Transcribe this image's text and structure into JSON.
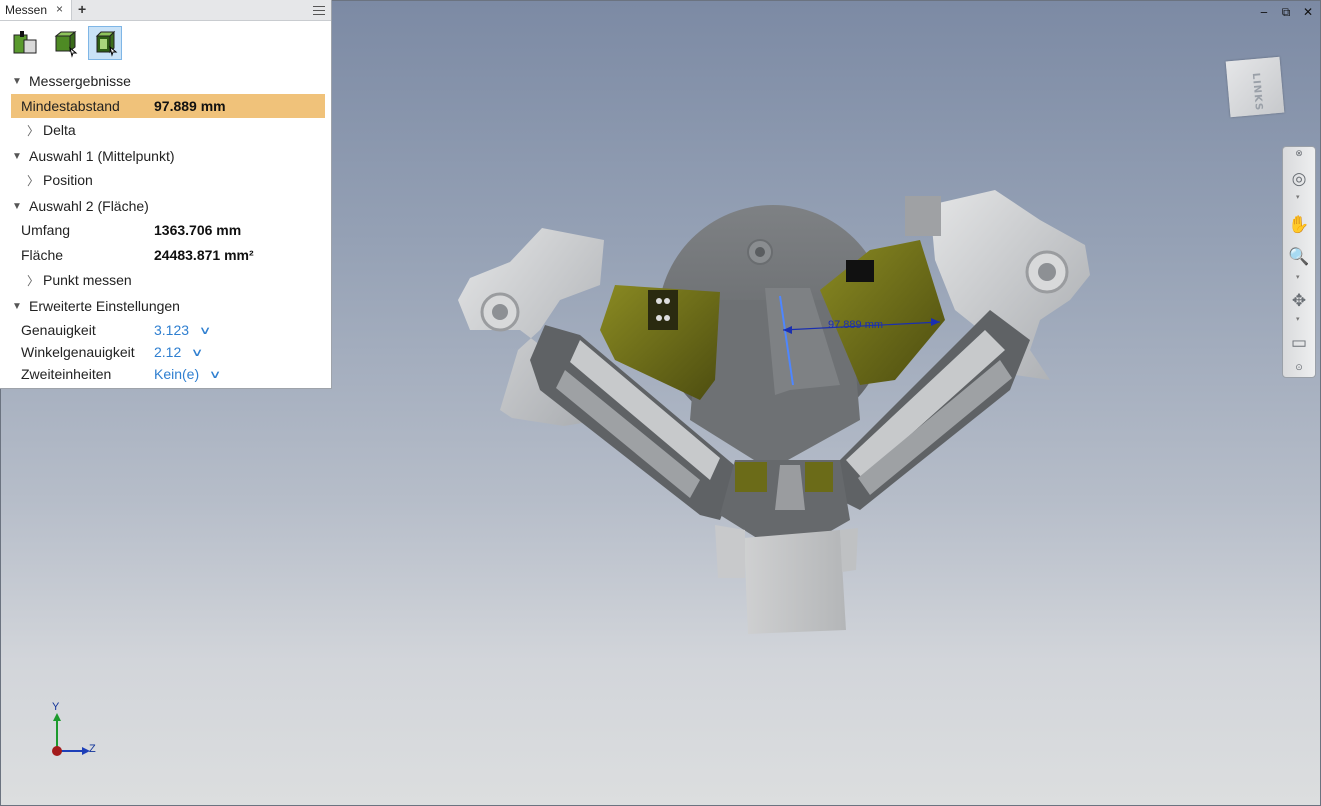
{
  "panel": {
    "tab_label": "Messen",
    "tab_close": "×",
    "tab_add": "+",
    "tools": [
      {
        "name": "measure-distance-icon"
      },
      {
        "name": "measure-face-icon"
      },
      {
        "name": "measure-select-icon",
        "active": true
      }
    ],
    "sections": {
      "results": {
        "title": "Messergebnisse",
        "min_distance_label": "Mindestabstand",
        "min_distance_value": "97.889 mm",
        "delta_label": "Delta"
      },
      "selection1": {
        "title": "Auswahl 1 (Mittelpunkt)",
        "position_label": "Position"
      },
      "selection2": {
        "title": "Auswahl 2 (Fläche)",
        "perimeter_label": "Umfang",
        "perimeter_value": "1363.706 mm",
        "area_label": "Fläche",
        "area_value": "24483.871 mm²",
        "measure_point_label": "Punkt messen"
      },
      "advanced": {
        "title": "Erweiterte Einstellungen",
        "precision_label": "Genauigkeit",
        "precision_value": "3.123",
        "angular_precision_label": "Winkelgenauigkeit",
        "angular_precision_value": "2.12",
        "dual_units_label": "Zweiteinheiten",
        "dual_units_value": "Kein(e)"
      }
    }
  },
  "viewport": {
    "dimension_label": "97.889 mm",
    "viewcube_label": "LINKS",
    "axis_y": "Y",
    "axis_z": "Z",
    "window_controls": [
      "‒",
      "⧉",
      "✕"
    ]
  },
  "colors": {
    "highlight": "#f0c27a",
    "link_blue": "#2f7fd0",
    "dimension_blue": "#1a2fb0"
  }
}
